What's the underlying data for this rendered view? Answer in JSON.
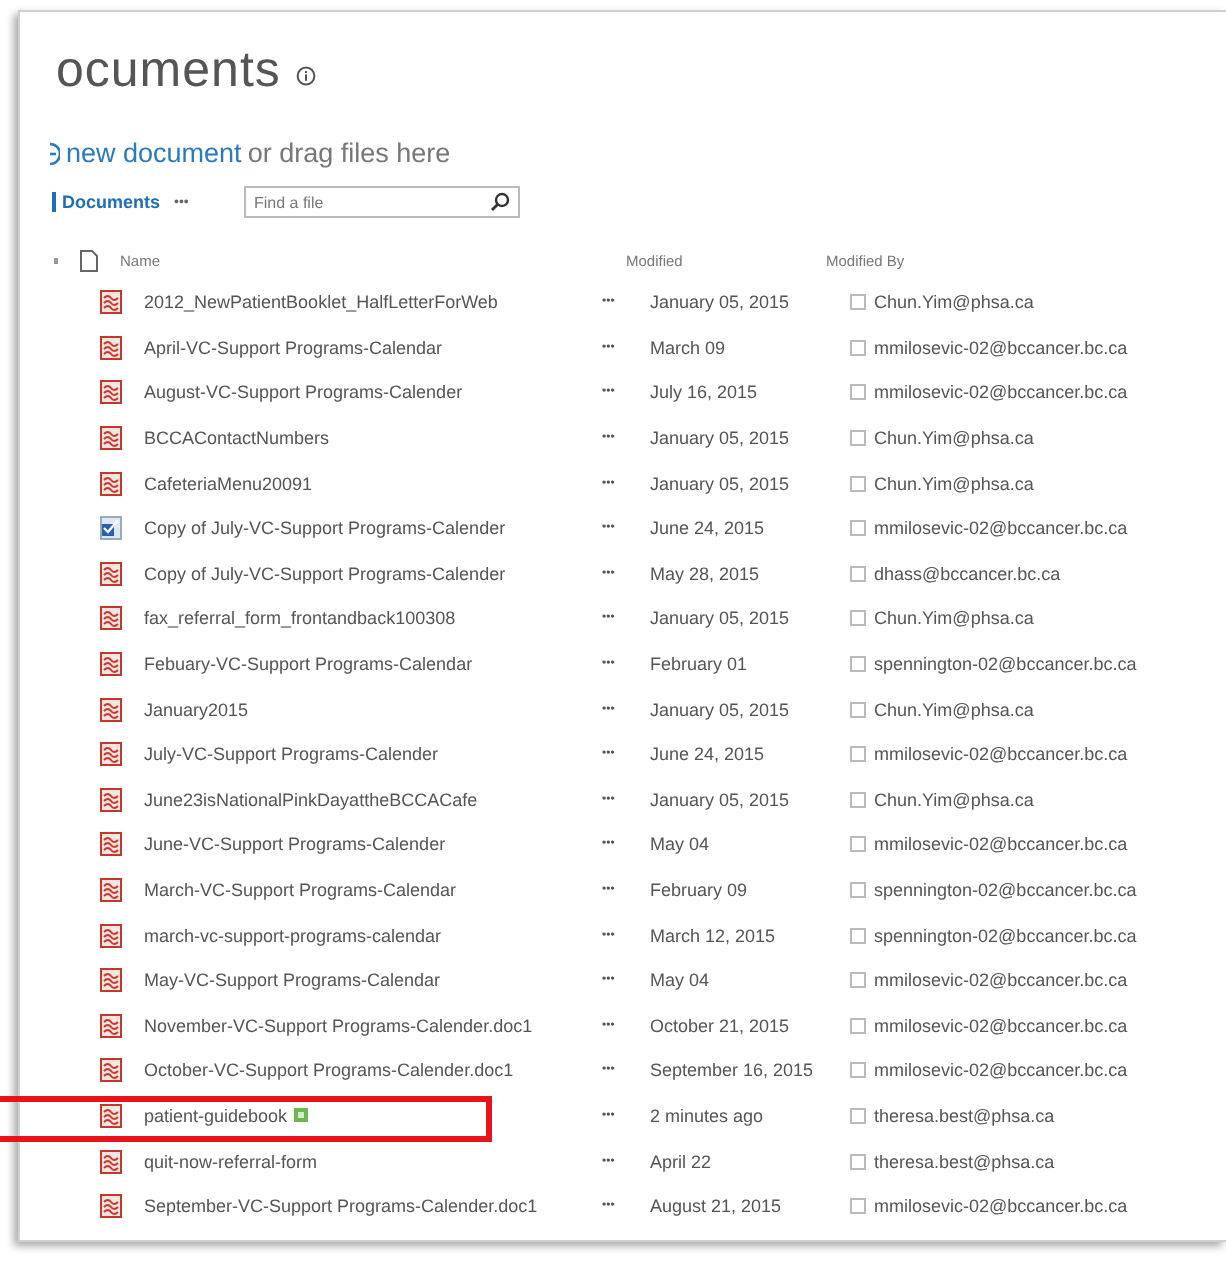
{
  "title": "ocuments",
  "upload": {
    "link": "new document",
    "rest": "or drag files here"
  },
  "toolbar": {
    "view": "Documents",
    "more": "•••",
    "search": {
      "placeholder": "Find a file"
    }
  },
  "columns": [
    {
      "label": "Name"
    },
    {
      "label": "Modified"
    },
    {
      "label": "Modified By"
    }
  ],
  "rows": [
    {
      "kind": "pdf",
      "name": "2012_NewPatientBooklet_HalfLetterForWeb",
      "modified": "January 05, 2015",
      "by": "Chun.Yim@phsa.ca",
      "is_new": false,
      "highlighted": false
    },
    {
      "kind": "pdf",
      "name": "April-VC-Support Programs-Calendar",
      "modified": "March 09",
      "by": "mmilosevic-02@bccancer.bc.ca",
      "is_new": false,
      "highlighted": false
    },
    {
      "kind": "pdf",
      "name": "August-VC-Support Programs-Calender",
      "modified": "July 16, 2015",
      "by": "mmilosevic-02@bccancer.bc.ca",
      "is_new": false,
      "highlighted": false
    },
    {
      "kind": "pdf",
      "name": "BCCAContactNumbers",
      "modified": "January 05, 2015",
      "by": "Chun.Yim@phsa.ca",
      "is_new": false,
      "highlighted": false
    },
    {
      "kind": "pdf",
      "name": "CafeteriaMenu20091",
      "modified": "January 05, 2015",
      "by": "Chun.Yim@phsa.ca",
      "is_new": false,
      "highlighted": false
    },
    {
      "kind": "word",
      "name": "Copy of July-VC-Support Programs-Calender",
      "modified": "June 24, 2015",
      "by": "mmilosevic-02@bccancer.bc.ca",
      "is_new": false,
      "highlighted": false
    },
    {
      "kind": "pdf",
      "name": "Copy of July-VC-Support Programs-Calender",
      "modified": "May 28, 2015",
      "by": "dhass@bccancer.bc.ca",
      "is_new": false,
      "highlighted": false
    },
    {
      "kind": "pdf",
      "name": "fax_referral_form_frontandback100308",
      "modified": "January 05, 2015",
      "by": "Chun.Yim@phsa.ca",
      "is_new": false,
      "highlighted": false
    },
    {
      "kind": "pdf",
      "name": "Febuary-VC-Support Programs-Calendar",
      "modified": "February 01",
      "by": "spennington-02@bccancer.bc.ca",
      "is_new": false,
      "highlighted": false
    },
    {
      "kind": "pdf",
      "name": "January2015",
      "modified": "January 05, 2015",
      "by": "Chun.Yim@phsa.ca",
      "is_new": false,
      "highlighted": false
    },
    {
      "kind": "pdf",
      "name": "July-VC-Support Programs-Calender",
      "modified": "June 24, 2015",
      "by": "mmilosevic-02@bccancer.bc.ca",
      "is_new": false,
      "highlighted": false
    },
    {
      "kind": "pdf",
      "name": "June23isNationalPinkDayattheBCCACafe",
      "modified": "January 05, 2015",
      "by": "Chun.Yim@phsa.ca",
      "is_new": false,
      "highlighted": false
    },
    {
      "kind": "pdf",
      "name": "June-VC-Support Programs-Calender",
      "modified": "May 04",
      "by": "mmilosevic-02@bccancer.bc.ca",
      "is_new": false,
      "highlighted": false
    },
    {
      "kind": "pdf",
      "name": "March-VC-Support Programs-Calendar",
      "modified": "February 09",
      "by": "spennington-02@bccancer.bc.ca",
      "is_new": false,
      "highlighted": false
    },
    {
      "kind": "pdf",
      "name": "march-vc-support-programs-calendar",
      "modified": "March 12, 2015",
      "by": "spennington-02@bccancer.bc.ca",
      "is_new": false,
      "highlighted": false
    },
    {
      "kind": "pdf",
      "name": "May-VC-Support Programs-Calendar",
      "modified": "May 04",
      "by": "mmilosevic-02@bccancer.bc.ca",
      "is_new": false,
      "highlighted": false
    },
    {
      "kind": "pdf",
      "name": "November-VC-Support Programs-Calender.doc1",
      "modified": "October 21, 2015",
      "by": "mmilosevic-02@bccancer.bc.ca",
      "is_new": false,
      "highlighted": false
    },
    {
      "kind": "pdf",
      "name": "October-VC-Support Programs-Calender.doc1",
      "modified": "September 16, 2015",
      "by": "mmilosevic-02@bccancer.bc.ca",
      "is_new": false,
      "highlighted": false
    },
    {
      "kind": "pdf",
      "name": "patient-guidebook",
      "modified": "2 minutes ago",
      "by": "theresa.best@phsa.ca",
      "is_new": true,
      "highlighted": true
    },
    {
      "kind": "pdf",
      "name": "quit-now-referral-form",
      "modified": "April 22",
      "by": "theresa.best@phsa.ca",
      "is_new": false,
      "highlighted": false
    },
    {
      "kind": "pdf",
      "name": "September-VC-Support Programs-Calender.doc1",
      "modified": "August 21, 2015",
      "by": "mmilosevic-02@bccancer.bc.ca",
      "is_new": false,
      "highlighted": false
    }
  ],
  "row_menu": "•••"
}
